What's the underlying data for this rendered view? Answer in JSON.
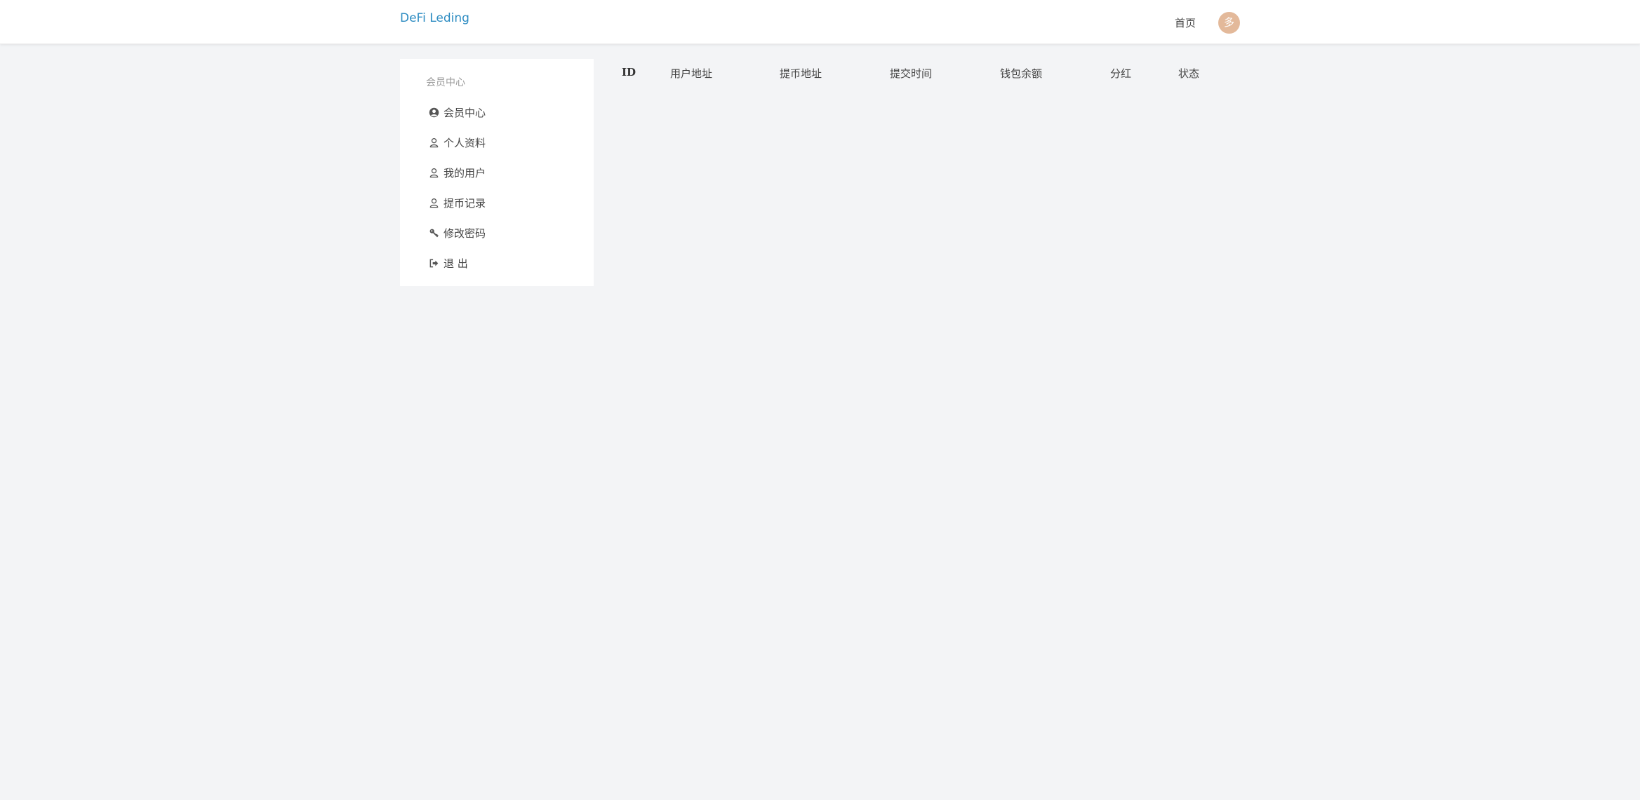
{
  "header": {
    "brand": "DeFi Leding",
    "home_label": "首页",
    "avatar_text": "多"
  },
  "sidebar": {
    "heading": "会员中心",
    "items": [
      {
        "label": "会员中心",
        "icon": "user-circle-icon"
      },
      {
        "label": "个人资料",
        "icon": "user-icon"
      },
      {
        "label": "我的用户",
        "icon": "user-icon"
      },
      {
        "label": "提币记录",
        "icon": "user-icon"
      },
      {
        "label": "修改密码",
        "icon": "key-icon"
      },
      {
        "label": "退 出",
        "icon": "sign-out-icon"
      }
    ]
  },
  "table": {
    "columns": [
      "ID",
      "用户地址",
      "提币地址",
      "提交时间",
      "钱包余额",
      "分红",
      "状态"
    ],
    "rows": []
  },
  "colors": {
    "brand": "#2d8cc2",
    "avatar_bg": "#e3b99a",
    "page_bg": "#f3f4f6"
  }
}
